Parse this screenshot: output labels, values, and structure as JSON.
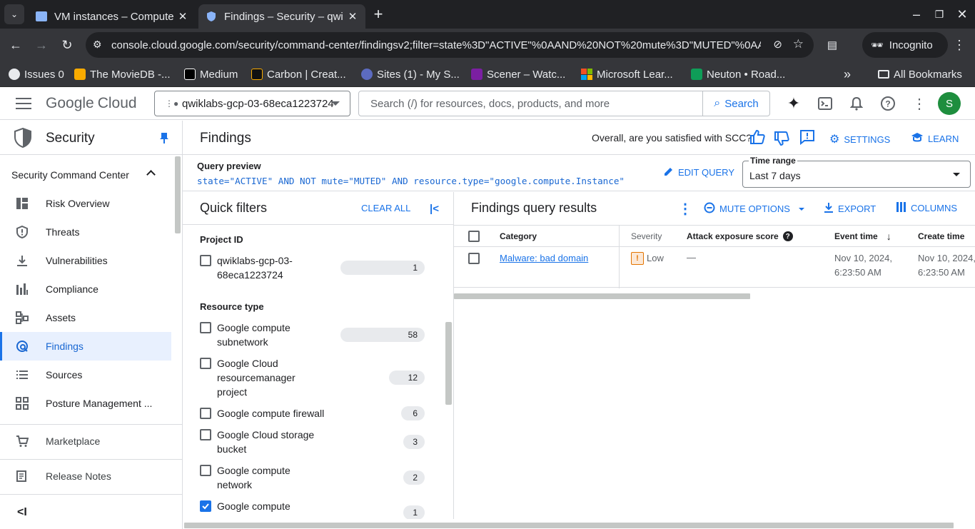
{
  "browser": {
    "tabs": [
      {
        "title": "VM instances – Compute",
        "active": false
      },
      {
        "title": "Findings – Security – qwi",
        "active": true
      }
    ],
    "url": "console.cloud.google.com/security/command-center/findingsv2;filter=state%3D\"ACTIVE\"%0AAND%20NOT%20mute%3D\"MUTED\"%0AAND...",
    "incognito_label": "Incognito",
    "bookmarks": [
      {
        "label": "Issues 0",
        "color": "#5f6368"
      },
      {
        "label": "The MovieDB -...",
        "color": "#f9ab00"
      },
      {
        "label": "Medium",
        "color": "#000000"
      },
      {
        "label": "Carbon | Creat...",
        "color": "#2b2b2b"
      },
      {
        "label": "Sites (1) - My S...",
        "color": "#5c6bc0"
      },
      {
        "label": "Scener – Watc...",
        "color": "#7b1fa2"
      },
      {
        "label": "Microsoft Lear...",
        "color": "#f25022"
      },
      {
        "label": "Neuton • Road...",
        "color": "#0f9d58"
      }
    ],
    "all_bookmarks": "All Bookmarks"
  },
  "header": {
    "logo_google": "Google",
    "logo_cloud": "Cloud",
    "project": "qwiklabs-gcp-03-68eca1223724",
    "search_placeholder": "Search (/) for resources, docs, products, and more",
    "search_button": "Search",
    "avatar_letter": "S"
  },
  "sidebar": {
    "title": "Security",
    "section": "Security Command Center",
    "items": [
      {
        "label": "Risk Overview",
        "icon": "dashboard-icon"
      },
      {
        "label": "Threats",
        "icon": "shield-icon"
      },
      {
        "label": "Vulnerabilities",
        "icon": "download-icon"
      },
      {
        "label": "Compliance",
        "icon": "bar-chart-icon"
      },
      {
        "label": "Assets",
        "icon": "assets-icon"
      },
      {
        "label": "Findings",
        "icon": "findings-icon"
      },
      {
        "label": "Sources",
        "icon": "list-icon"
      },
      {
        "label": "Posture Management ...",
        "icon": "apps-icon"
      }
    ],
    "marketplace": "Marketplace",
    "release_notes": "Release Notes",
    "collapse_label": "<I"
  },
  "page": {
    "title": "Findings",
    "feedback_question": "Overall, are you satisfied with SCC?",
    "settings": "SETTINGS",
    "learn": "LEARN",
    "query_label": "Query preview",
    "query_text": "state=\"ACTIVE\" AND NOT mute=\"MUTED\" AND resource.type=\"google.compute.Instance\"",
    "edit_query": "EDIT QUERY",
    "time_range_label": "Time range",
    "time_range_value": "Last 7 days"
  },
  "quick_filters": {
    "title": "Quick filters",
    "clear_all": "CLEAR ALL",
    "project_heading": "Project ID",
    "projects": [
      {
        "label_line1": "qwiklabs-gcp-03-",
        "label_line2": "68eca1223724",
        "count": "1",
        "checked": false
      }
    ],
    "resource_heading": "Resource type",
    "resources": [
      {
        "lines": [
          "Google compute",
          "subnetwork"
        ],
        "count": "58",
        "checked": false
      },
      {
        "lines": [
          "Google Cloud",
          "resourcemanager",
          "project"
        ],
        "count": "12",
        "checked": false
      },
      {
        "lines": [
          "Google compute firewall"
        ],
        "count": "6",
        "checked": false
      },
      {
        "lines": [
          "Google Cloud storage",
          "bucket"
        ],
        "count": "3",
        "checked": false
      },
      {
        "lines": [
          "Google compute",
          "network"
        ],
        "count": "2",
        "checked": false
      },
      {
        "lines": [
          "Google compute"
        ],
        "count": "1",
        "checked": true
      }
    ]
  },
  "results": {
    "title": "Findings query results",
    "mute_options": "MUTE OPTIONS",
    "export": "EXPORT",
    "columns": "COLUMNS",
    "headers": {
      "category": "Category",
      "severity": "Severity",
      "attack": "Attack exposure score",
      "event_time": "Event time",
      "create_time": "Create time"
    },
    "rows": [
      {
        "category": "Malware: bad domain",
        "severity": "Low",
        "attack": "—",
        "event_time_1": "Nov 10, 2024,",
        "event_time_2": "6:23:50 AM",
        "create_time_1": "Nov 10, 2024,",
        "create_time_2": "6:23:50 AM"
      }
    ]
  }
}
